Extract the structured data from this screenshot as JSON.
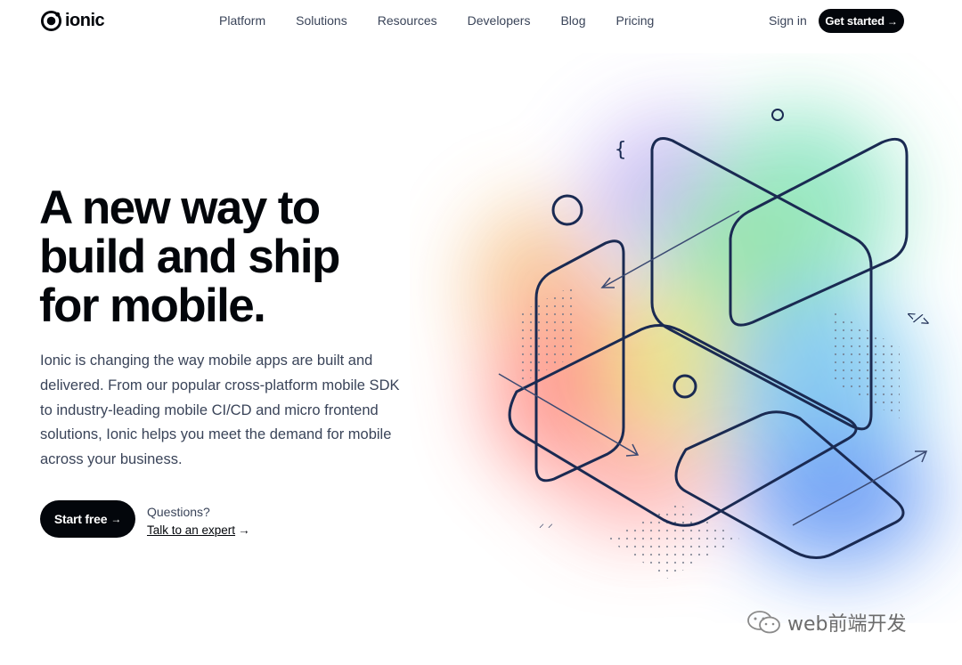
{
  "brand": {
    "name": "ionic"
  },
  "nav": {
    "links": [
      "Platform",
      "Solutions",
      "Resources",
      "Developers",
      "Blog",
      "Pricing"
    ],
    "signin": "Sign in",
    "cta": "Get started",
    "arrow": "→"
  },
  "hero": {
    "title_lines": [
      "A new way to",
      "build and ship",
      "for mobile."
    ],
    "description": "Ionic is changing the way mobile apps are built and delivered. From our popular cross-platform mobile SDK to industry-leading mobile CI/CD and micro frontend solutions, Ionic helps you meet the demand for mobile across your business.",
    "primary_cta": "Start free",
    "questions": "Questions?",
    "talk_link": "Talk to an expert",
    "arrow": "→"
  },
  "illustration": {
    "glyph_brace": "{",
    "glyph_code": "</>",
    "glyph_dash": "⸝ ⸝"
  },
  "watermark": {
    "text": "web前端开发"
  },
  "colors": {
    "ink": "#03060b",
    "muted": "#3a4459",
    "shape_stroke": "#1a2a52"
  },
  "icons": [
    "ionic-logo-icon",
    "arrow-right-icon",
    "wechat-icon"
  ]
}
